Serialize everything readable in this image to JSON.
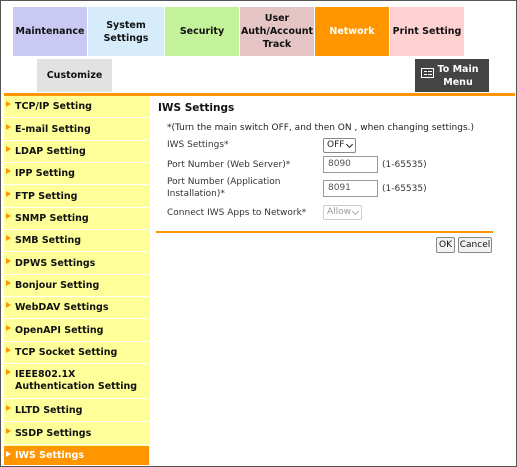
{
  "tabs": {
    "maintenance": "Maintenance",
    "system_settings": "System Settings",
    "security": "Security",
    "user_auth": "User Auth/Account Track",
    "network": "Network",
    "print_setting": "Print Setting",
    "customize": "Customize"
  },
  "main_menu": {
    "label": "To Main Menu",
    "icon": "main-menu-icon"
  },
  "sidebar": {
    "items": [
      {
        "label": "TCP/IP Setting"
      },
      {
        "label": "E-mail Setting"
      },
      {
        "label": "LDAP Setting"
      },
      {
        "label": "IPP Setting"
      },
      {
        "label": "FTP Setting"
      },
      {
        "label": "SNMP Setting"
      },
      {
        "label": "SMB Setting"
      },
      {
        "label": "DPWS Settings"
      },
      {
        "label": "Bonjour Setting"
      },
      {
        "label": "WebDAV Settings"
      },
      {
        "label": "OpenAPI Setting"
      },
      {
        "label": "TCP Socket Setting"
      },
      {
        "label": "IEEE802.1X Authentication Setting"
      },
      {
        "label": "LLTD Setting"
      },
      {
        "label": "SSDP Settings"
      },
      {
        "label": "IWS Settings"
      }
    ],
    "active": "IWS Settings"
  },
  "content": {
    "title": "IWS Settings",
    "note": "*(Turn the main switch OFF, and then ON , when changing settings.)",
    "iws_settings": {
      "label": "IWS Settings*",
      "value": "OFF"
    },
    "port_web": {
      "label": "Port Number (Web Server)*",
      "value": "8090",
      "range": "(1-65535)"
    },
    "port_app": {
      "label": "Port Number (Application Installation)*",
      "value": "8091",
      "range": "(1-65535)"
    },
    "connect_apps": {
      "label": "Connect IWS Apps to Network*",
      "value": "Allow"
    },
    "ok_label": "OK",
    "cancel_label": "Cancel"
  },
  "colors": {
    "accent": "#ff9600",
    "sidebar_bg": "#ffff99",
    "tab_maintenance": "#c9c9f4",
    "tab_system": "#d7ecfa",
    "tab_security": "#c4f29a",
    "tab_user": "#e4c4c4",
    "tab_print": "#ffd1d1",
    "tab_customize": "#e2e2e2"
  }
}
